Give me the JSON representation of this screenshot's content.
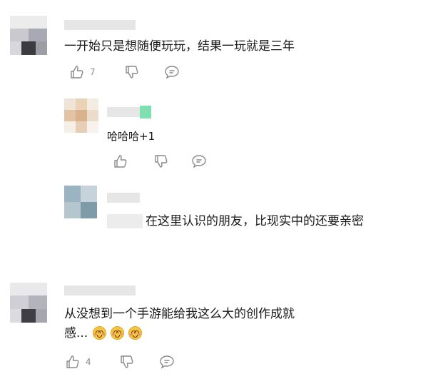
{
  "comments": [
    {
      "text": "一开始只是想随便玩玩，结果一玩就是三年",
      "like_count": "7",
      "icons": [
        "thumbs-up-icon",
        "thumbs-down-icon",
        "comment-icon"
      ],
      "replies": [
        {
          "text": "哈哈哈+1",
          "icons": [
            "thumbs-up-icon",
            "thumbs-down-icon",
            "comment-icon"
          ]
        },
        {
          "text": "在这里认识的朋友，比现实中的还要亲密"
        }
      ]
    },
    {
      "text_line1": "从没想到一个手游能给我这么大的创作成就",
      "text_line2": "感...",
      "emoji": [
        "smiling-face-emoji",
        "smiling-face-emoji",
        "smiling-face-emoji"
      ],
      "like_count": "4",
      "icons": [
        "thumbs-up-icon",
        "thumbs-down-icon",
        "comment-icon"
      ]
    }
  ],
  "colors": {
    "text": "#1a1a1a",
    "icon": "#8a8a8a",
    "count": "#8a8a8a",
    "blur": "#e6e6e6"
  }
}
